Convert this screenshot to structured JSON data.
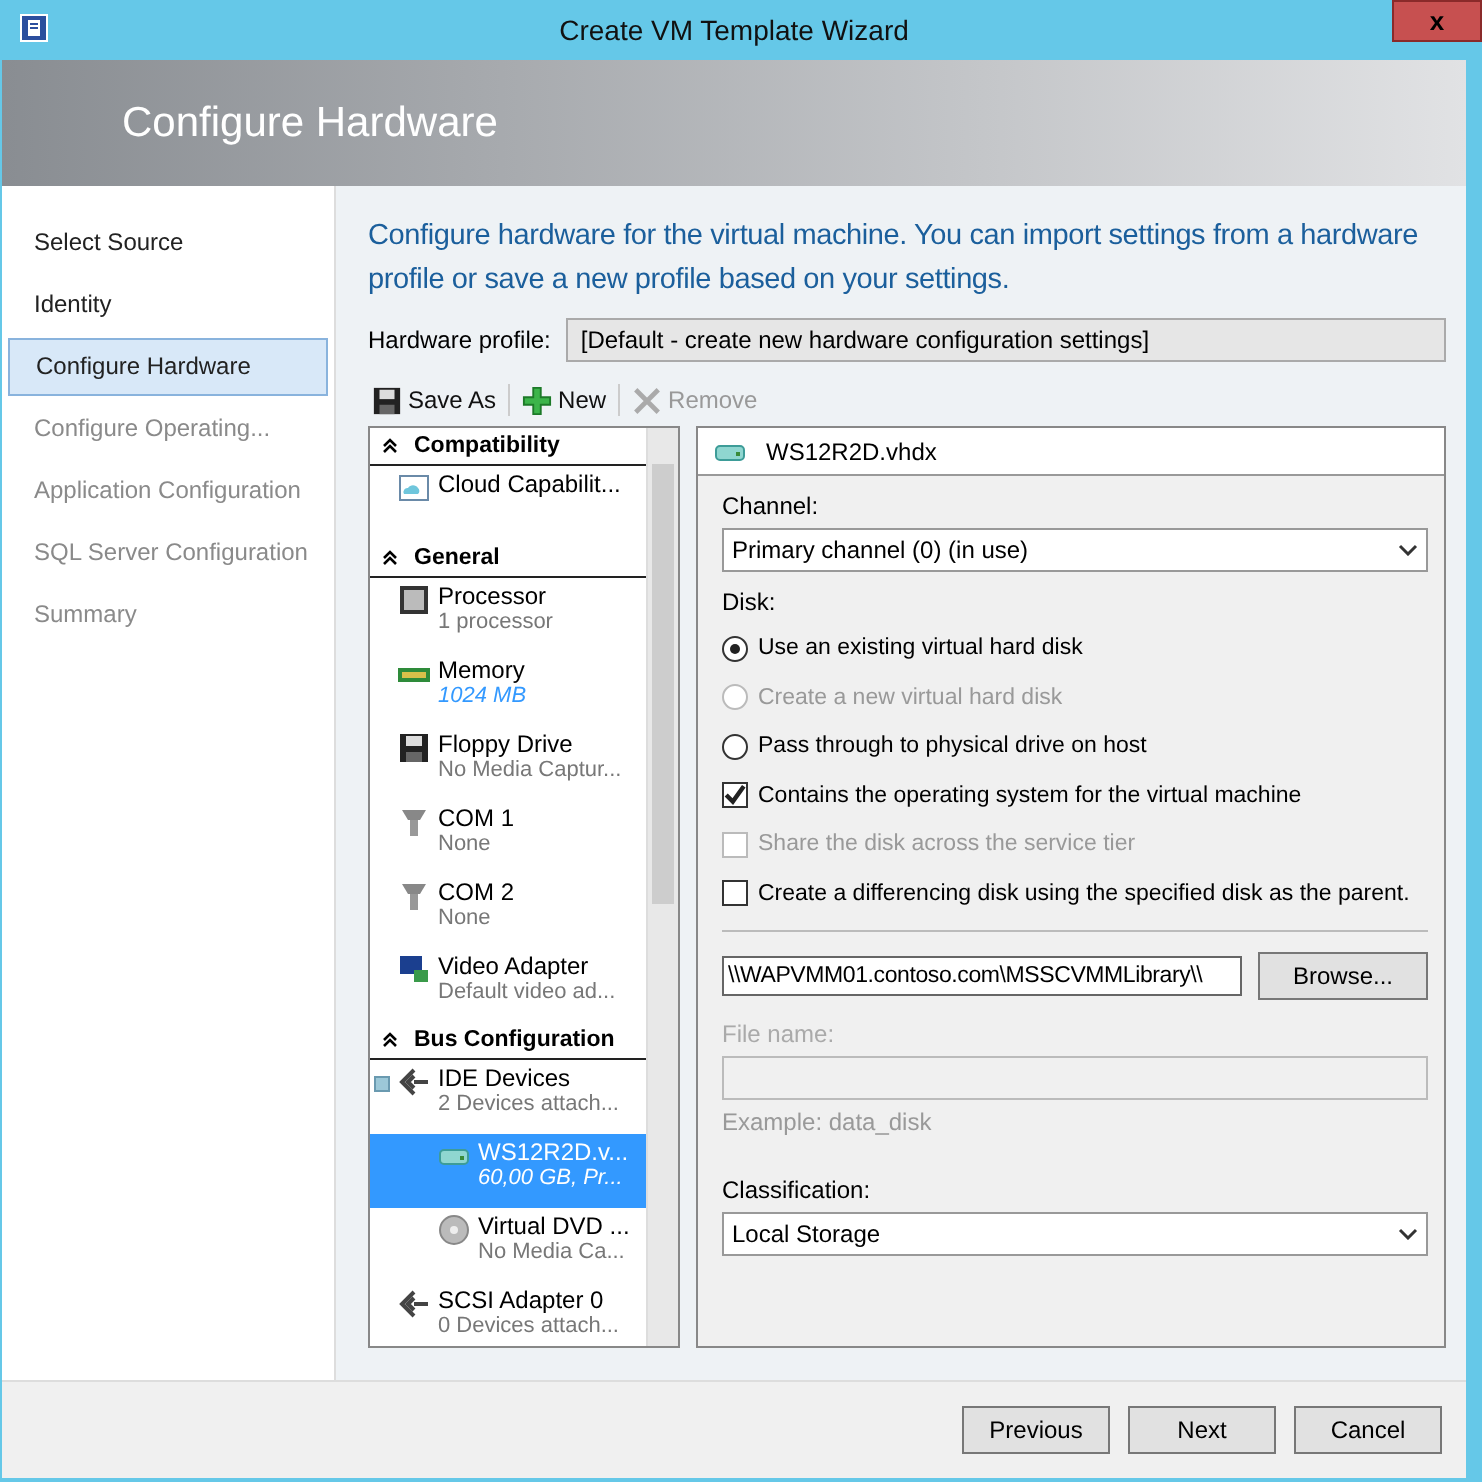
{
  "window": {
    "title": "Create VM Template Wizard",
    "close": "x"
  },
  "header": {
    "title": "Configure Hardware"
  },
  "nav": [
    {
      "label": "Select Source",
      "selected": false,
      "disabled": false
    },
    {
      "label": "Identity",
      "selected": false,
      "disabled": false
    },
    {
      "label": "Configure Hardware",
      "selected": true,
      "disabled": false
    },
    {
      "label": "Configure Operating...",
      "selected": false,
      "disabled": true
    },
    {
      "label": "Application Configuration",
      "selected": false,
      "disabled": true
    },
    {
      "label": "SQL Server Configuration",
      "selected": false,
      "disabled": true
    },
    {
      "label": "Summary",
      "selected": false,
      "disabled": true
    }
  ],
  "intro": "Configure hardware for the virtual machine. You can import settings from a hardware profile or save a new profile based on your settings.",
  "hardware_profile": {
    "label": "Hardware profile:",
    "value": "[Default - create new hardware configuration settings]"
  },
  "toolbar": [
    {
      "kind": "save",
      "label": "Save As",
      "disabled": false
    },
    {
      "kind": "add",
      "label": "New",
      "disabled": false
    },
    {
      "kind": "remove",
      "label": "Remove",
      "disabled": true
    }
  ],
  "tree": [
    {
      "kind": "section",
      "label": "Compatibility"
    },
    {
      "kind": "cloud",
      "label": "Cloud Capabilit...",
      "selected": false
    },
    {
      "kind": "section",
      "label": "General"
    },
    {
      "kind": "processor",
      "label": "Processor",
      "detail": "1 processor",
      "selected": false
    },
    {
      "kind": "memory",
      "label": "Memory",
      "detail": "1024 MB",
      "selected": false
    },
    {
      "kind": "floppy",
      "label": "Floppy Drive",
      "detail": "No Media Captur...",
      "selected": false
    },
    {
      "kind": "port",
      "label": "COM 1",
      "detail": "None",
      "selected": false
    },
    {
      "kind": "port",
      "label": "COM 2",
      "detail": "None",
      "selected": false
    },
    {
      "kind": "video",
      "label": "Video Adapter",
      "detail": "Default video ad...",
      "selected": false
    },
    {
      "kind": "section",
      "label": "Bus Configuration"
    },
    {
      "kind": "bus",
      "label": "IDE Devices",
      "detail": "2 Devices attach...",
      "selected": false,
      "expanded": true,
      "children": [
        {
          "kind": "disk",
          "label": "WS12R2D.v...",
          "detail": "60,00 GB, Pr...",
          "selected": true
        },
        {
          "kind": "dvd",
          "label": "Virtual DVD ...",
          "detail": "No Media Ca...",
          "selected": false
        }
      ]
    },
    {
      "kind": "bus",
      "label": "SCSI Adapter 0",
      "detail": "0 Devices attach...",
      "selected": false
    }
  ],
  "detail": {
    "title": "WS12R2D.vhdx",
    "channel": {
      "label": "Channel:",
      "value": "Primary channel (0) (in use)"
    },
    "disk_label": "Disk:",
    "options": [
      {
        "kind": "radio",
        "label": "Use an existing virtual hard disk",
        "selected": true,
        "disabled": false
      },
      {
        "kind": "radio",
        "label": "Create a new virtual hard disk",
        "selected": false,
        "disabled": true
      },
      {
        "kind": "radio",
        "label": "Pass through to physical drive on host",
        "selected": false,
        "disabled": false
      },
      {
        "kind": "checkbox",
        "label": "Contains the operating system for the virtual machine",
        "checked": true,
        "disabled": false
      },
      {
        "kind": "checkbox",
        "label": "Share the disk across the service tier",
        "checked": false,
        "disabled": true
      },
      {
        "kind": "checkbox",
        "label": "Create a differencing disk using the specified disk as the parent.",
        "checked": false,
        "disabled": false
      }
    ],
    "path": "\\\\WAPVMM01.contoso.com\\MSSCVMMLibrary\\\\",
    "browse": "Browse...",
    "file_name": {
      "label": "File name:",
      "disabled": true,
      "hint": "Example: data_disk"
    },
    "classification": {
      "label": "Classification:",
      "value": "Local Storage"
    }
  },
  "buttons": [
    {
      "label": "Previous"
    },
    {
      "label": "Next"
    },
    {
      "label": "Cancel"
    }
  ]
}
